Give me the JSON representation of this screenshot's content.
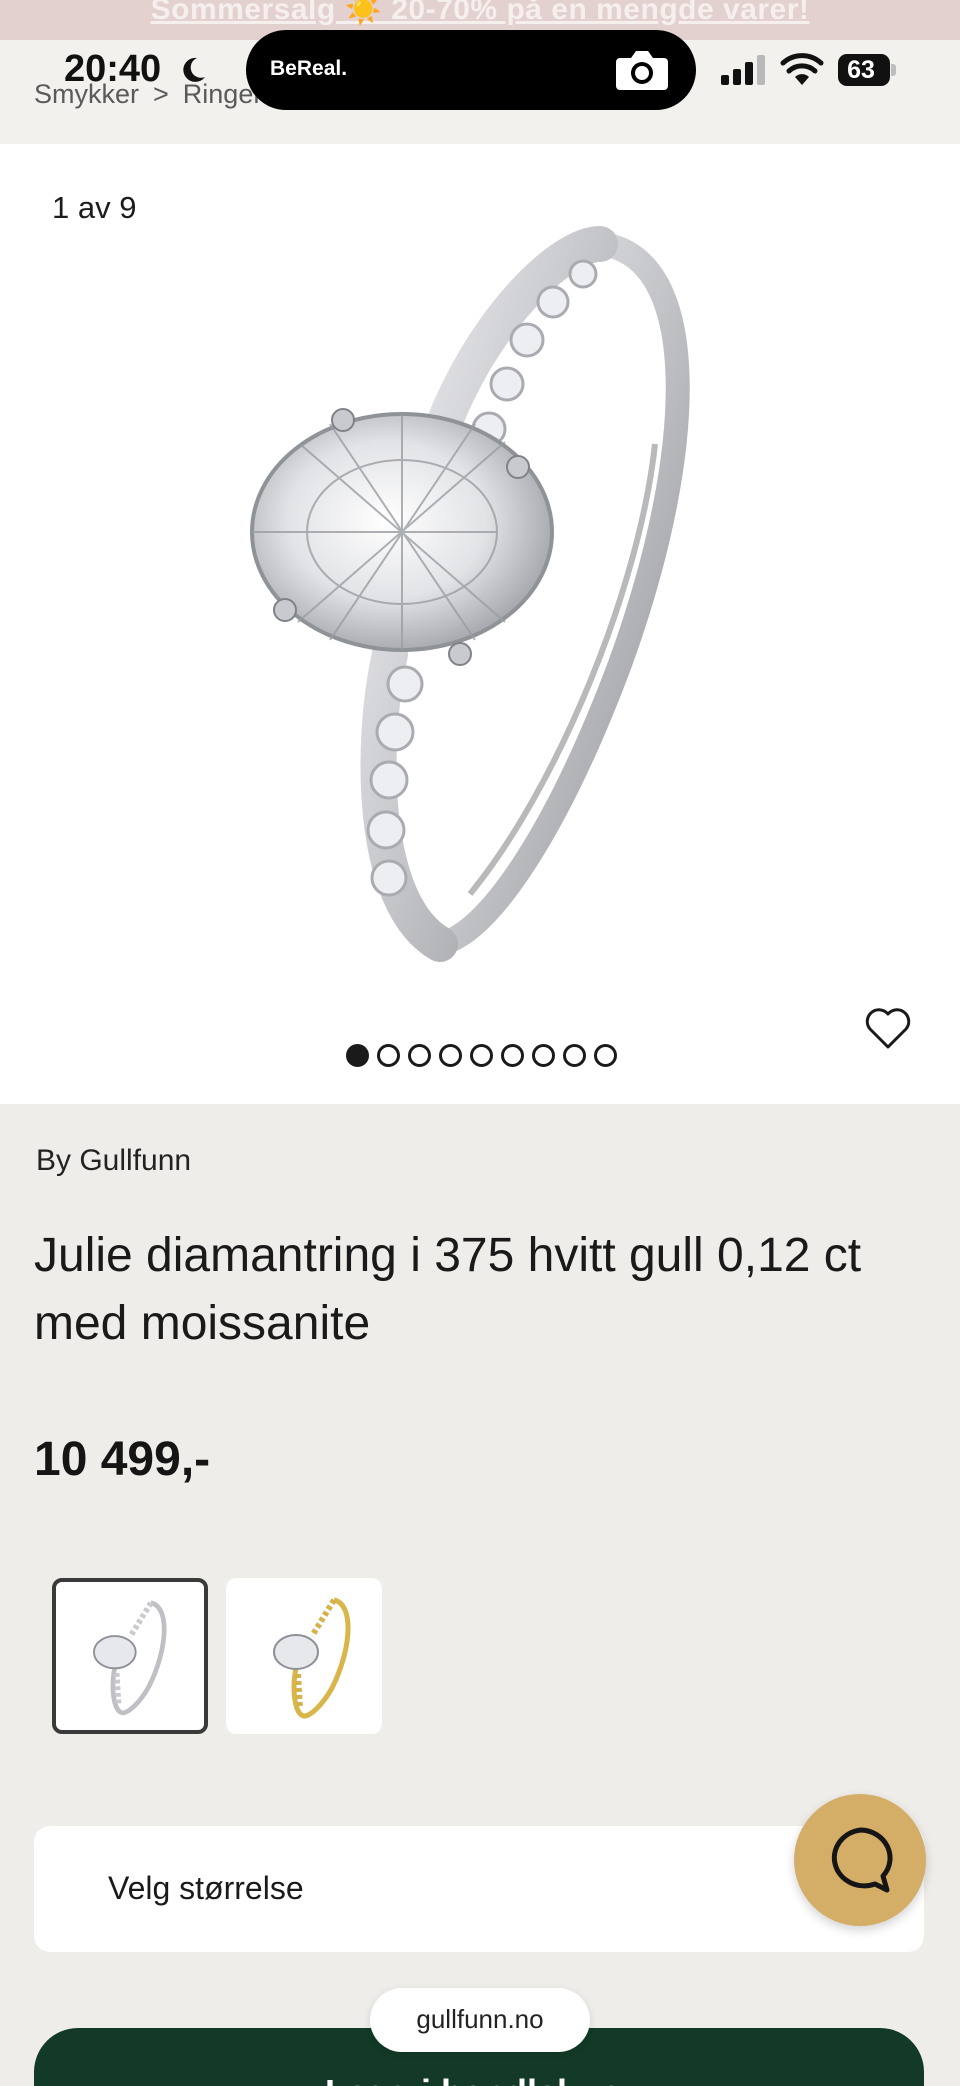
{
  "promo": {
    "text": "Sommersalg ☀️ 20-70% på en mengde varer!"
  },
  "status_bar": {
    "time": "20:40",
    "island_app": "BeReal.",
    "battery": "63"
  },
  "breadcrumb": {
    "items": [
      "Smykker",
      "Ringer"
    ],
    "separator": ">"
  },
  "gallery": {
    "counter": "1 av 9",
    "total": 9,
    "active_index": 0
  },
  "product": {
    "brand": "By Gullfunn",
    "title": "Julie diamantring i 375 hvitt gull 0,12 ct med moissanite",
    "price": "10 499,-"
  },
  "variants": [
    {
      "name": "white-gold",
      "metal_color": "#c9c9cc",
      "selected": true
    },
    {
      "name": "yellow-gold",
      "metal_color": "#d8b64a",
      "selected": false
    }
  ],
  "size_select": {
    "label": "Velg størrelse"
  },
  "cart": {
    "label": "Legg i handlekurv"
  },
  "browser": {
    "url": "gullfunn.no"
  },
  "colors": {
    "background": "#efedea",
    "cart_button": "#123a27",
    "chat_button": "#d4ad66",
    "promo_banner": "#e3d1cf"
  },
  "icons": {
    "wishlist": "heart-outline-icon",
    "chat": "chat-bubble-icon",
    "camera": "camera-icon",
    "moon": "moon-icon"
  }
}
